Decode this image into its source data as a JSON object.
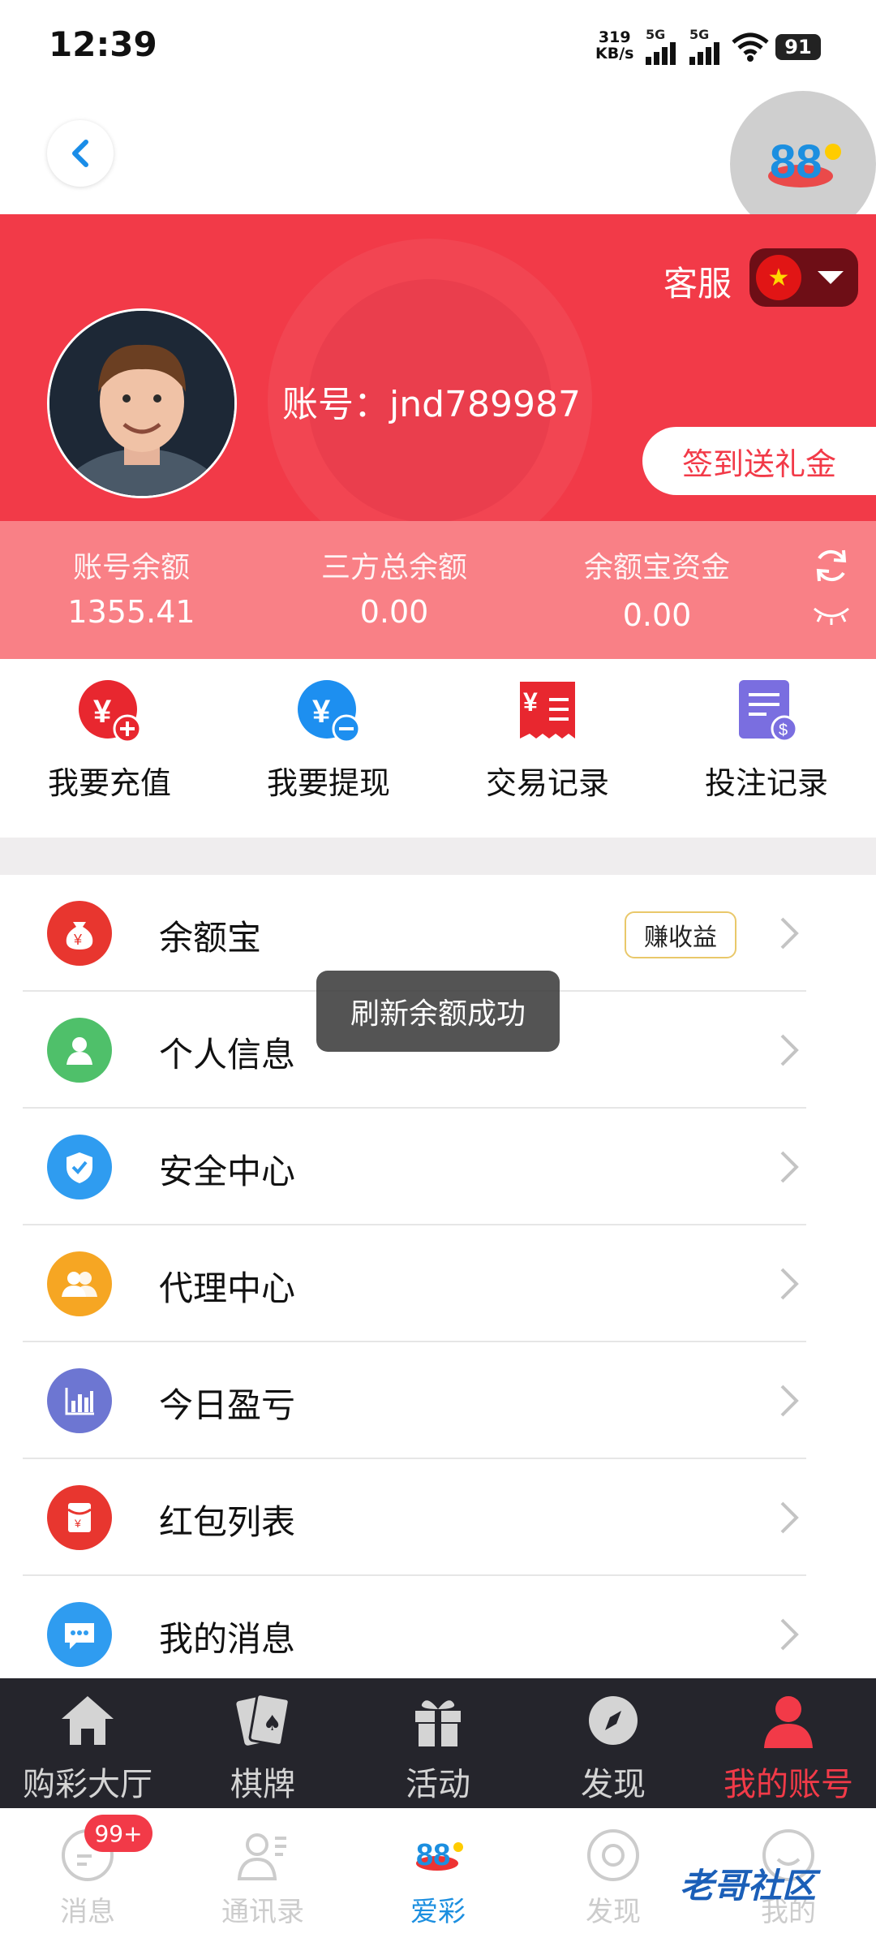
{
  "status_bar": {
    "time": "12:39",
    "net_speed_value": "319",
    "net_speed_unit": "KB/s",
    "signal1": "5G",
    "signal2": "5G",
    "battery": "91"
  },
  "header": {
    "back_icon": "chevron-left-icon",
    "logo_text": "88"
  },
  "profile": {
    "service_label": "客服",
    "flag_icon": "china-flag-icon",
    "account_label": "账号：jnd789987",
    "checkin_label": "签到送礼金",
    "colors": {
      "banner": "#f23a48",
      "balance_band": "#f98086"
    }
  },
  "balances": [
    {
      "label": "账号余额",
      "value": "1355.41"
    },
    {
      "label": "三方总余额",
      "value": "0.00"
    },
    {
      "label": "余额宝资金",
      "value": "0.00"
    }
  ],
  "quick_actions": [
    {
      "label": "我要充值",
      "icon": "recharge-icon"
    },
    {
      "label": "我要提现",
      "icon": "withdraw-icon"
    },
    {
      "label": "交易记录",
      "icon": "transaction-record-icon"
    },
    {
      "label": "投注记录",
      "icon": "bet-record-icon"
    }
  ],
  "menu": [
    {
      "label": "余额宝",
      "icon": "money-bag-icon",
      "color": "#e8362f",
      "badge": "赚收益"
    },
    {
      "label": "个人信息",
      "icon": "person-icon",
      "color": "#4fc06a"
    },
    {
      "label": "安全中心",
      "icon": "shield-icon",
      "color": "#2f9cf0"
    },
    {
      "label": "代理中心",
      "icon": "agents-icon",
      "color": "#f6a623"
    },
    {
      "label": "今日盈亏",
      "icon": "bar-chart-icon",
      "color": "#6d76d2"
    },
    {
      "label": "红包列表",
      "icon": "red-envelope-icon",
      "color": "#e8362f"
    },
    {
      "label": "我的消息",
      "icon": "message-icon",
      "color": "#2f9cf0"
    }
  ],
  "toast": "刷新余额成功",
  "dark_tabs": [
    {
      "label": "购彩大厅",
      "icon": "home-icon"
    },
    {
      "label": "棋牌",
      "icon": "cards-icon"
    },
    {
      "label": "活动",
      "icon": "gift-icon"
    },
    {
      "label": "发现",
      "icon": "compass-icon"
    },
    {
      "label": "我的账号",
      "icon": "user-icon",
      "active": true
    }
  ],
  "bottom_nav": [
    {
      "label": "消息",
      "icon": "chat-icon"
    },
    {
      "label": "通讯录",
      "icon": "contacts-icon"
    },
    {
      "label": "爱彩",
      "icon": "lottery-logo-icon",
      "active": true
    },
    {
      "label": "发现",
      "icon": "discover-icon"
    },
    {
      "label": "我的",
      "icon": "me-icon"
    }
  ],
  "unread_badge": "99+",
  "watermark": "老哥社区"
}
